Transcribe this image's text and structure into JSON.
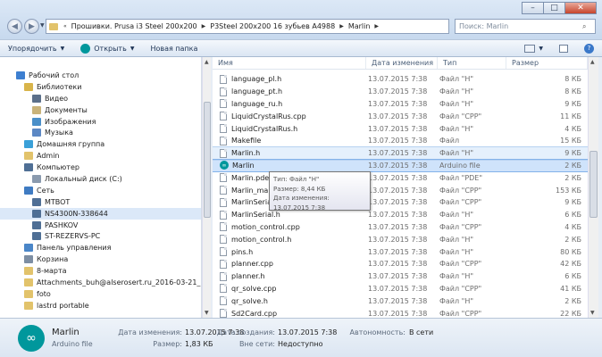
{
  "address": {
    "crumbs": [
      "Прошивки. Prusa i3 Steel 200x200",
      "P3Steel 200x200 16 зубьев A4988",
      "Marlin"
    ],
    "search_placeholder": "Поиск: Marlin"
  },
  "toolbar": {
    "organize": "Упорядочить",
    "open": "Открыть",
    "new_folder": "Новая папка"
  },
  "nav": {
    "items": [
      {
        "label": "Рабочий стол",
        "indent": 0,
        "icon": "desktop-icon",
        "color": "#3d7fd0"
      },
      {
        "label": "Библиотеки",
        "indent": 1,
        "icon": "libraries-icon",
        "color": "#d8b44a"
      },
      {
        "label": "Видео",
        "indent": 2,
        "icon": "video-icon",
        "color": "#5b6f8a"
      },
      {
        "label": "Документы",
        "indent": 2,
        "icon": "documents-icon",
        "color": "#c9b37a"
      },
      {
        "label": "Изображения",
        "indent": 2,
        "icon": "images-icon",
        "color": "#4a8fc9"
      },
      {
        "label": "Музыка",
        "indent": 2,
        "icon": "music-icon",
        "color": "#5c88c4"
      },
      {
        "label": "Домашняя группа",
        "indent": 1,
        "icon": "homegroup-icon",
        "color": "#3aa0d8"
      },
      {
        "label": "Admin",
        "indent": 1,
        "icon": "user-folder-icon",
        "color": "#e2c36b"
      },
      {
        "label": "Компьютер",
        "indent": 1,
        "icon": "computer-icon",
        "color": "#4f6f95"
      },
      {
        "label": "Локальный диск (C:)",
        "indent": 2,
        "icon": "drive-icon",
        "color": "#8a9aae"
      },
      {
        "label": "Сеть",
        "indent": 1,
        "icon": "network-icon",
        "color": "#3f7bc2"
      },
      {
        "label": "MTBOT",
        "indent": 2,
        "icon": "computer-icon",
        "color": "#4f6f95"
      },
      {
        "label": "NS4300N-338644",
        "indent": 2,
        "icon": "computer-icon",
        "color": "#4f6f95",
        "selected": true
      },
      {
        "label": "PASHKOV",
        "indent": 2,
        "icon": "computer-icon",
        "color": "#4f6f95"
      },
      {
        "label": "ST-REZERVS-PC",
        "indent": 2,
        "icon": "computer-icon",
        "color": "#4f6f95"
      },
      {
        "label": "Панель управления",
        "indent": 1,
        "icon": "control-panel-icon",
        "color": "#4a86c8"
      },
      {
        "label": "Корзина",
        "indent": 1,
        "icon": "recycle-bin-icon",
        "color": "#7d8ea3"
      },
      {
        "label": "8-марта",
        "indent": 1,
        "icon": "folder-icon",
        "color": "#e2c36b"
      },
      {
        "label": "Attachments_buh@alserosert.ru_2016-03-21_12-13-4",
        "indent": 1,
        "icon": "folder-icon",
        "color": "#e2c36b"
      },
      {
        "label": "foto",
        "indent": 1,
        "icon": "folder-icon",
        "color": "#e2c36b"
      },
      {
        "label": "lastrd portable",
        "indent": 1,
        "icon": "folder-icon",
        "color": "#e2c36b"
      }
    ]
  },
  "columns": {
    "name": "Имя",
    "date": "Дата изменения",
    "type": "Тип",
    "size": "Размер"
  },
  "files": [
    {
      "name": "language_pl.h",
      "date": "13.07.2015 7:38",
      "type": "Файл \"H\"",
      "size": "8 КБ"
    },
    {
      "name": "language_pt.h",
      "date": "13.07.2015 7:38",
      "type": "Файл \"H\"",
      "size": "8 КБ"
    },
    {
      "name": "language_ru.h",
      "date": "13.07.2015 7:38",
      "type": "Файл \"H\"",
      "size": "9 КБ"
    },
    {
      "name": "LiquidCrystalRus.cpp",
      "date": "13.07.2015 7:38",
      "type": "Файл \"CPP\"",
      "size": "11 КБ"
    },
    {
      "name": "LiquidCrystalRus.h",
      "date": "13.07.2015 7:38",
      "type": "Файл \"H\"",
      "size": "4 КБ"
    },
    {
      "name": "Makefile",
      "date": "13.07.2015 7:38",
      "type": "Файл",
      "size": "15 КБ"
    },
    {
      "name": "Marlin.h",
      "date": "13.07.2015 7:38",
      "type": "Файл \"H\"",
      "size": "9 КБ",
      "state": "hl"
    },
    {
      "name": "Marlin",
      "date": "13.07.2015 7:38",
      "type": "Arduino file",
      "size": "2 КБ",
      "state": "hl2",
      "arduino": true
    },
    {
      "name": "Marlin.pde",
      "date": "13.07.2015 7:38",
      "type": "Файл \"PDE\"",
      "size": "2 КБ"
    },
    {
      "name": "Marlin_main.cpp",
      "date": "13.07.2015 7:38",
      "type": "Файл \"CPP\"",
      "size": "153 КБ"
    },
    {
      "name": "MarlinSerial.cpp",
      "date": "13.07.2015 7:38",
      "type": "Файл \"CPP\"",
      "size": "9 КБ"
    },
    {
      "name": "MarlinSerial.h",
      "date": "13.07.2015 7:38",
      "type": "Файл \"H\"",
      "size": "6 КБ"
    },
    {
      "name": "motion_control.cpp",
      "date": "13.07.2015 7:38",
      "type": "Файл \"CPP\"",
      "size": "4 КБ"
    },
    {
      "name": "motion_control.h",
      "date": "13.07.2015 7:38",
      "type": "Файл \"H\"",
      "size": "2 КБ"
    },
    {
      "name": "pins.h",
      "date": "13.07.2015 7:38",
      "type": "Файл \"H\"",
      "size": "80 КБ"
    },
    {
      "name": "planner.cpp",
      "date": "13.07.2015 7:38",
      "type": "Файл \"CPP\"",
      "size": "42 КБ"
    },
    {
      "name": "planner.h",
      "date": "13.07.2015 7:38",
      "type": "Файл \"H\"",
      "size": "6 КБ"
    },
    {
      "name": "qr_solve.cpp",
      "date": "13.07.2015 7:38",
      "type": "Файл \"CPP\"",
      "size": "41 КБ"
    },
    {
      "name": "qr_solve.h",
      "date": "13.07.2015 7:38",
      "type": "Файл \"H\"",
      "size": "2 КБ"
    },
    {
      "name": "Sd2Card.cpp",
      "date": "13.07.2015 7:38",
      "type": "Файл \"CPP\"",
      "size": "22 КБ"
    }
  ],
  "tooltip": {
    "line1": "Тип: Файл \"H\"",
    "line2": "Размер: 8,44 КБ",
    "line3": "Дата изменения: 13.07.2015 7:38"
  },
  "details": {
    "name": "Marlin",
    "type": "Arduino file",
    "modified_label": "Дата изменения:",
    "modified_value": "13.07.2015 7:38",
    "size_label": "Размер:",
    "size_value": "1,83 КБ",
    "created_label": "Дата создания:",
    "created_value": "13.07.2015 7:38",
    "offline_label": "Вне сети:",
    "offline_value": "Недоступно",
    "availability_label": "Автономность:",
    "availability_value": "В сети"
  },
  "colors": {
    "accent": "#3d7fd0",
    "arduino": "#00979c",
    "selection": "#cfe3fb"
  }
}
